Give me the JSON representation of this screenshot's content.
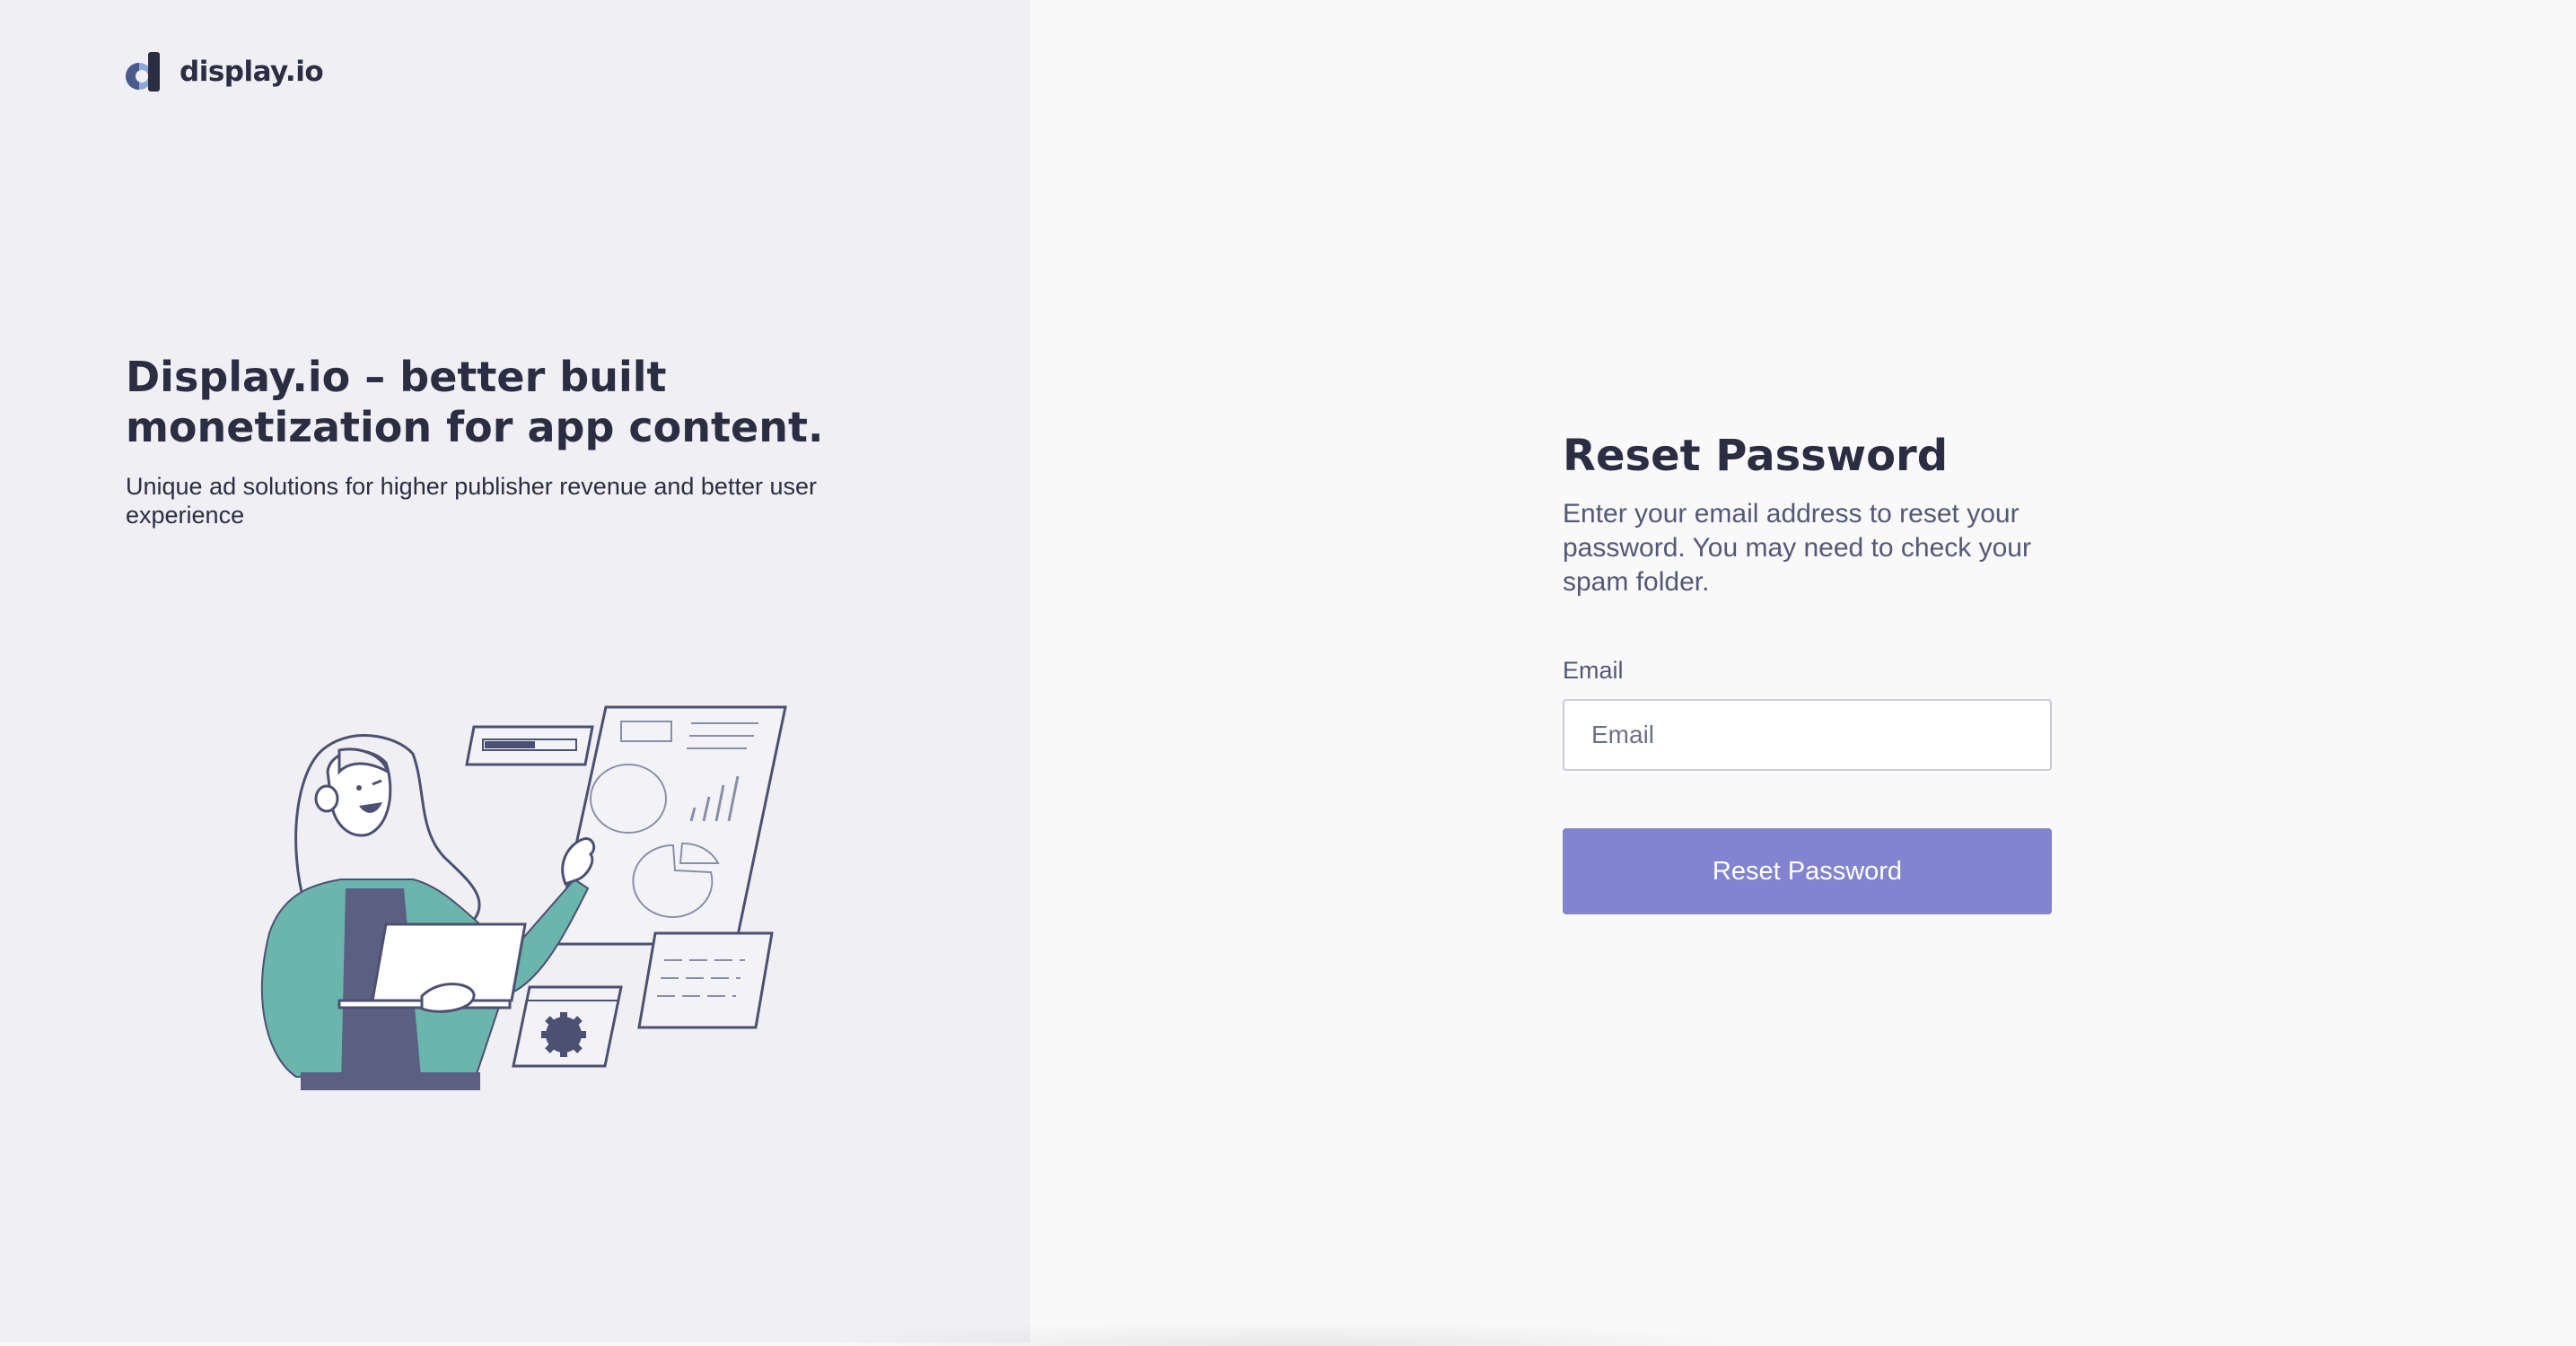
{
  "brand": {
    "name": "display.io"
  },
  "hero": {
    "headline": "Display.io – better built monetization for app content.",
    "subline": "Unique ad solutions for higher publisher revenue and better user experience"
  },
  "form": {
    "title": "Reset Password",
    "description": "Enter your email address to reset your password. You may need to check your spam folder.",
    "email_label": "Email",
    "email_placeholder": "Email",
    "email_value": "",
    "submit_label": "Reset Password"
  },
  "colors": {
    "left_panel_bg": "#efeff4",
    "right_panel_bg": "#f9f9f9",
    "heading_text": "#2b2d42",
    "body_text": "#535878",
    "button_bg": "#8284cf",
    "accent_teal": "#6bb5ad"
  },
  "icons": {
    "logo": "display-io-logo-icon",
    "illustration": "woman-presenting-dashboard-illustration"
  }
}
